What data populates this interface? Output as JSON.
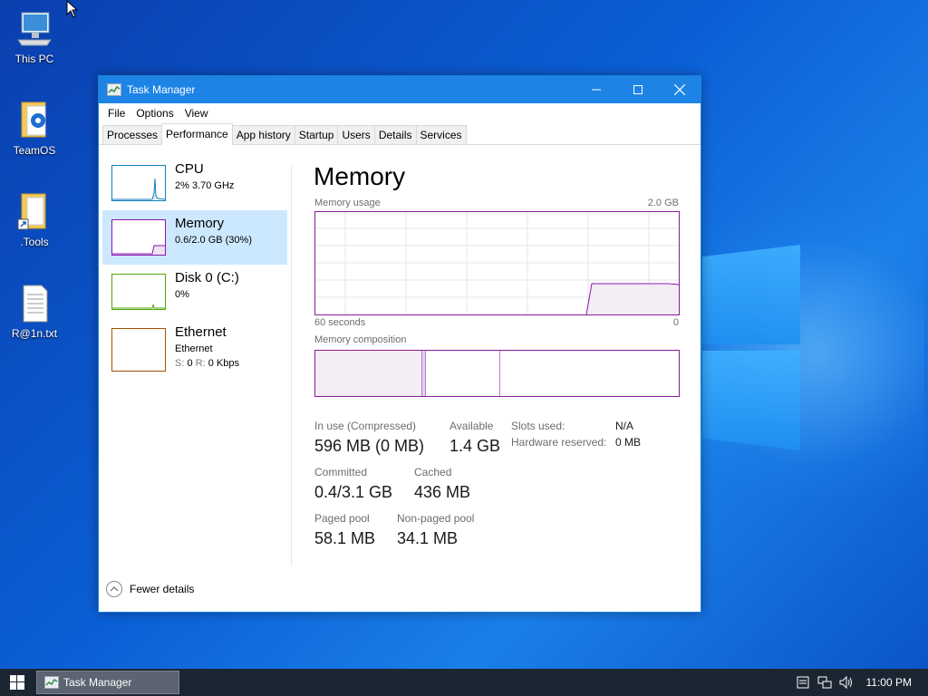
{
  "desktop": {
    "icons": [
      {
        "label": "This PC",
        "icon": "computer-icon"
      },
      {
        "label": "TeamOS",
        "icon": "folder-gear-icon"
      },
      {
        "label": ".Tools",
        "icon": "folder-shortcut-icon"
      },
      {
        "label": "R@1n.txt",
        "icon": "text-file-icon"
      }
    ]
  },
  "window": {
    "title": "Task Manager",
    "menu": [
      "File",
      "Options",
      "View"
    ],
    "tabs": [
      "Processes",
      "Performance",
      "App history",
      "Startup",
      "Users",
      "Details",
      "Services"
    ],
    "active_tab": "Performance"
  },
  "sidebar": {
    "items": [
      {
        "name": "CPU",
        "line1": "2%  3.70 GHz",
        "line2": "",
        "color": "#117dbb"
      },
      {
        "name": "Memory",
        "line1": "0.6/2.0 GB (30%)",
        "line2": "",
        "color": "#8b12ae"
      },
      {
        "name": "Disk 0 (C:)",
        "line1": "0%",
        "line2": "",
        "color": "#4da60c"
      },
      {
        "name": "Ethernet",
        "line1": "Ethernet",
        "line2_s": "S:",
        "line2_s_val": "0",
        "line2_r": "R:",
        "line2_r_val": "0 Kbps",
        "color": "#a74f01"
      }
    ],
    "selected": "Memory"
  },
  "memory": {
    "heading": "Memory",
    "usage_label": "Memory usage",
    "usage_max": "2.0 GB",
    "time_label": "60 seconds",
    "time_zero": "0",
    "composition_label": "Memory composition",
    "stats": {
      "in_use_label": "In use (Compressed)",
      "in_use_value": "596 MB (0 MB)",
      "available_label": "Available",
      "available_value": "1.4 GB",
      "slots_label": "Slots used:",
      "slots_value": "N/A",
      "hw_reserved_label": "Hardware reserved:",
      "hw_reserved_value": "0 MB",
      "committed_label": "Committed",
      "committed_value": "0.4/3.1 GB",
      "cached_label": "Cached",
      "cached_value": "436 MB",
      "paged_label": "Paged pool",
      "paged_value": "58.1 MB",
      "nonpaged_label": "Non-paged pool",
      "nonpaged_value": "34.1 MB"
    }
  },
  "footer": {
    "fewer_details": "Fewer details"
  },
  "taskbar": {
    "task_label": "Task Manager",
    "clock": "11:00 PM"
  }
}
